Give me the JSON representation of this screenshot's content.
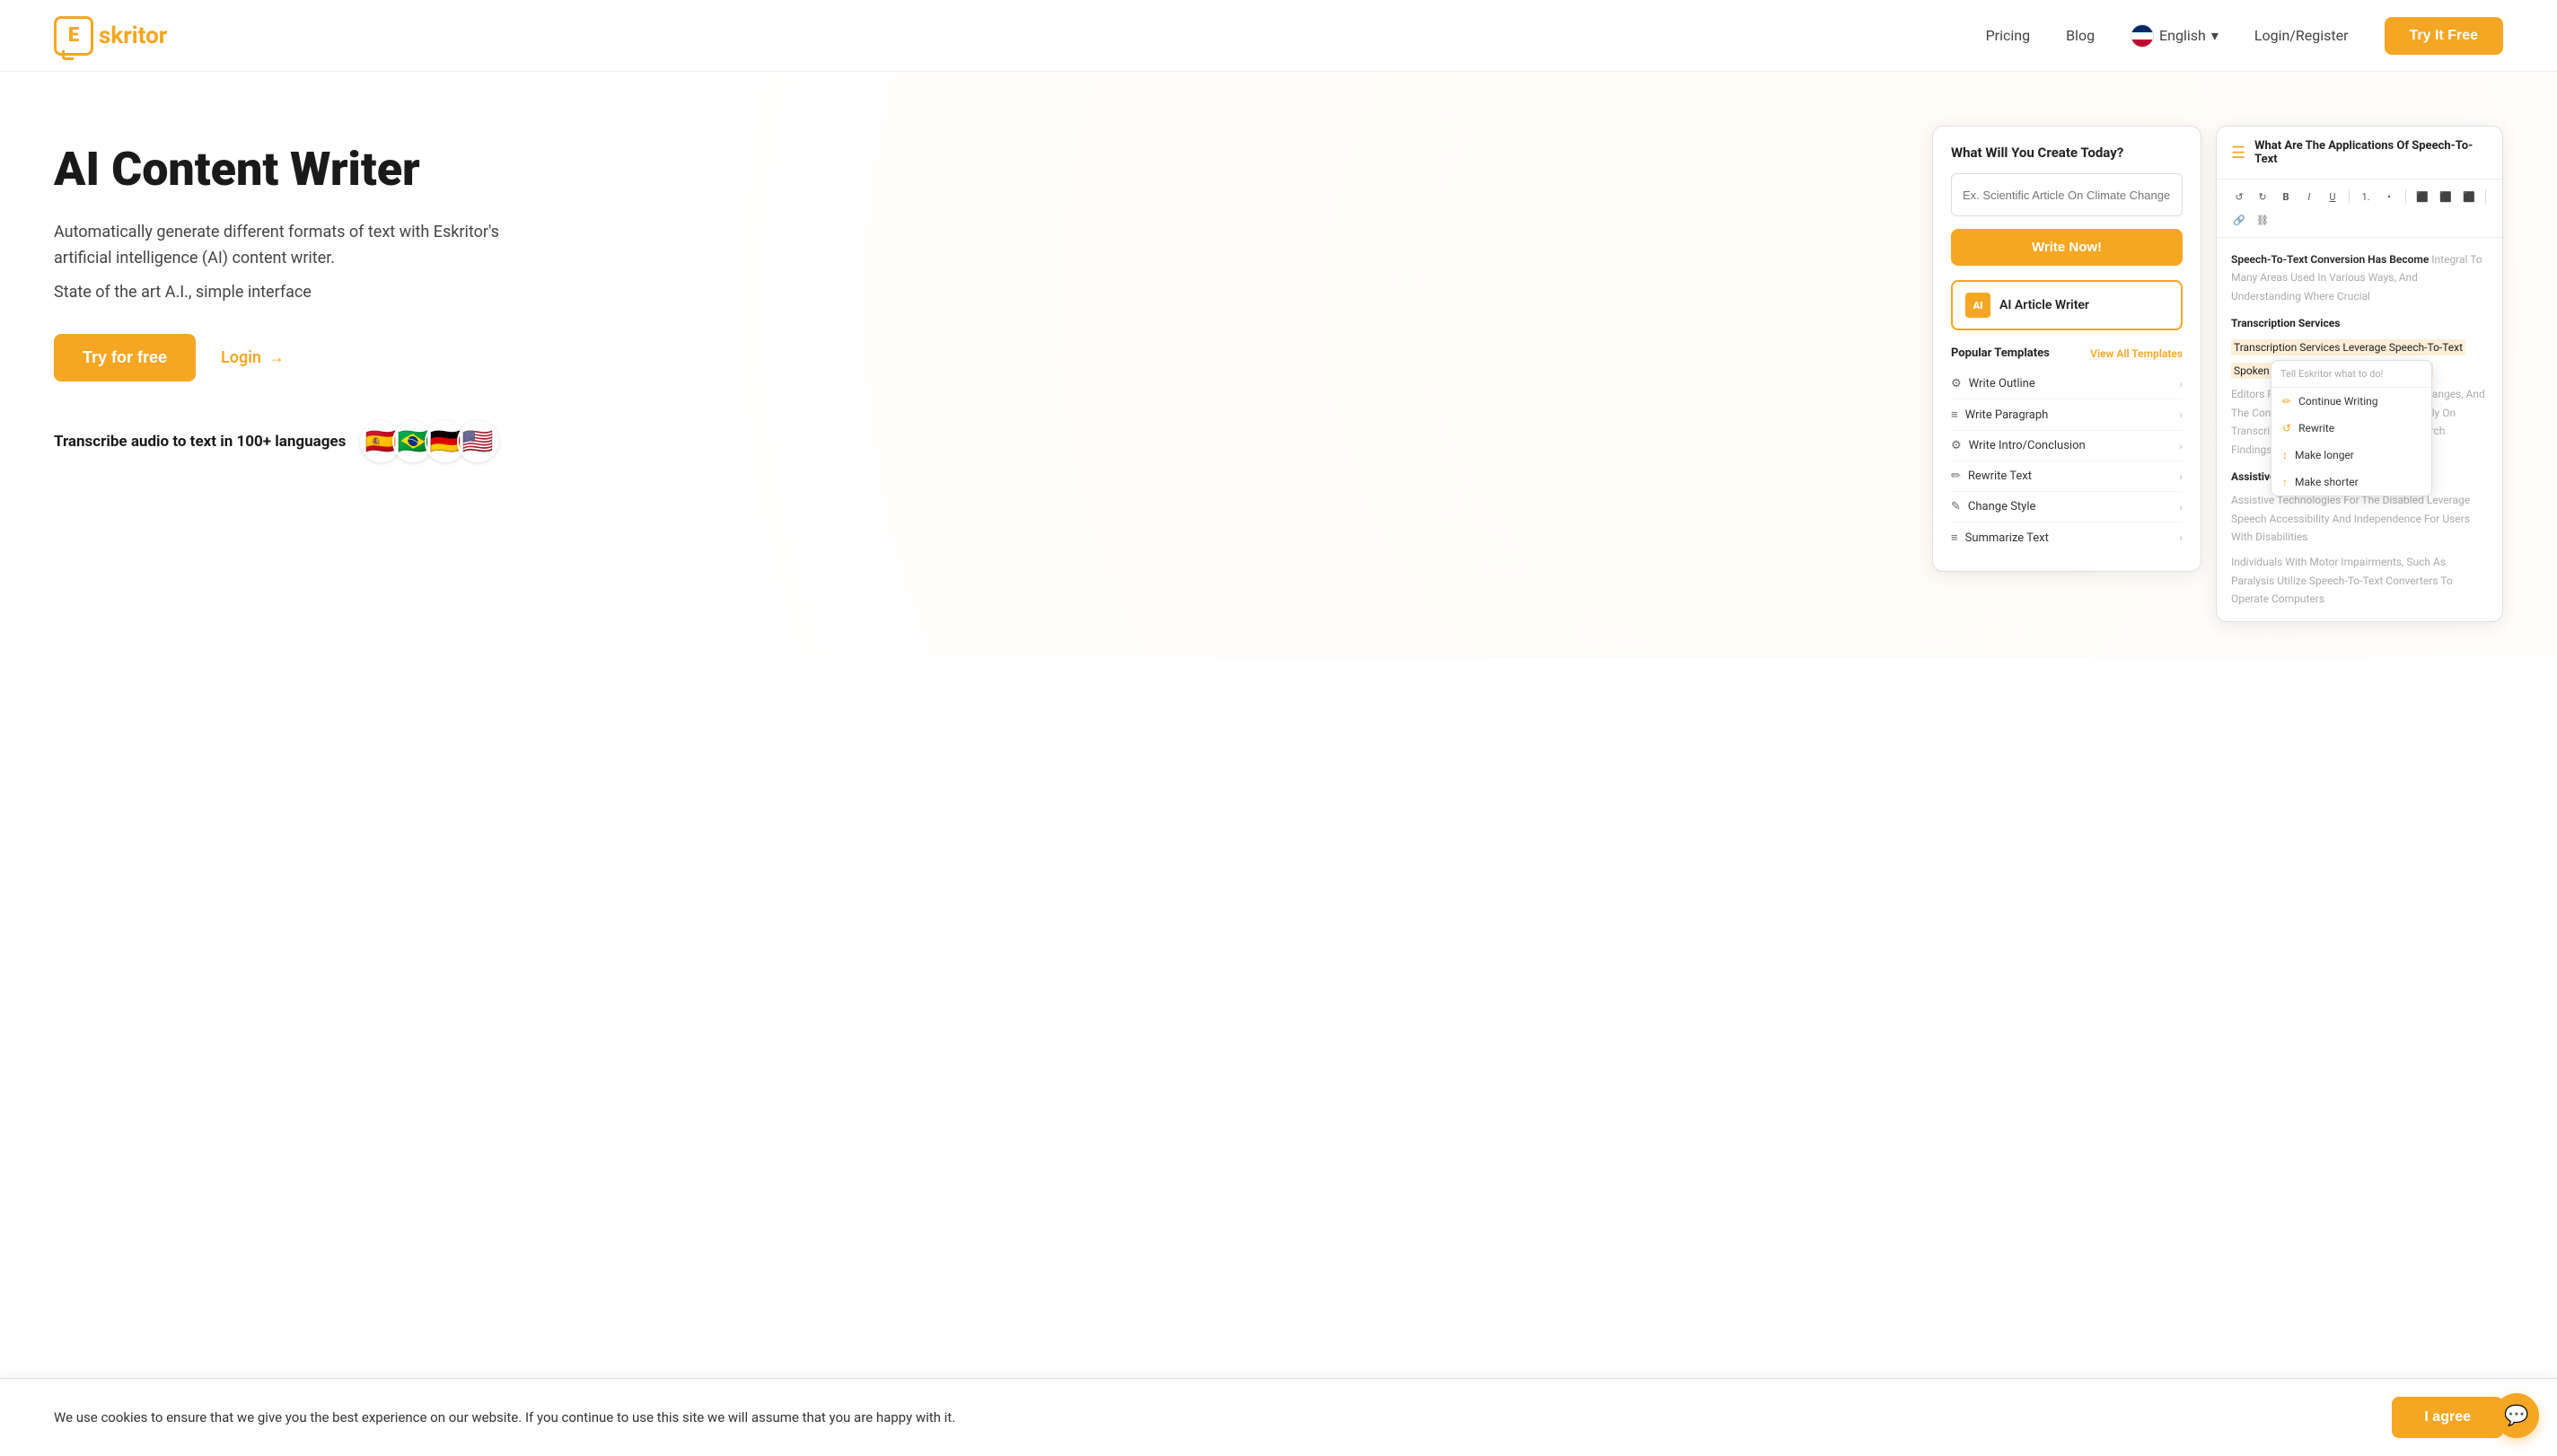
{
  "nav": {
    "logo_letter": "E",
    "logo_name": "skritor",
    "pricing": "Pricing",
    "blog": "Blog",
    "language": "English",
    "login_register": "Login/Register",
    "try_it_free": "Try It Free"
  },
  "hero": {
    "title": "AI Content Writer",
    "desc": "Automatically generate different formats of text with Eskritor's artificial intelligence (AI) content writer.",
    "sub": "State of the art A.I., simple interface",
    "btn_try": "Try for free",
    "btn_login": "Login",
    "transcribe": "Transcribe audio to text in 100+ languages",
    "flags": [
      "🇪🇸",
      "🇧🇷",
      "🇩🇪",
      "🇺🇸"
    ]
  },
  "left_panel": {
    "title": "What Will You Create Today?",
    "input_placeholder": "Ex. Scientific Article On Climate Change",
    "write_now": "Write Now!",
    "ai_article": "AI Article Writer",
    "popular_templates": "Popular Templates",
    "view_all": "View All Templates",
    "templates": [
      {
        "icon": "⚙",
        "label": "Write Outline"
      },
      {
        "icon": "≡",
        "label": "Write Paragraph"
      },
      {
        "icon": "⚙",
        "label": "Write Intro/Conclusion"
      },
      {
        "icon": "✏",
        "label": "Rewrite Text"
      },
      {
        "icon": "✎",
        "label": "Change Style"
      },
      {
        "icon": "≡",
        "label": "Summarize Text"
      }
    ]
  },
  "right_panel": {
    "title": "What Are The Applications Of Speech-To-Text",
    "editor_content": {
      "intro": "Speech-To-Text Conversion Has Become Integral To Many Areas Used In Various Ways, And Understanding Where Crucial",
      "section1": "Transcription Services",
      "highlighted_line1": "Transcription Services Leverage Speech-To-Text",
      "highlighted_line2": "Spoken Audio Into Written Text Efficiently",
      "body": "Editors Rewrite Interviews, Meetings, Exchanges, And The Convenience Of Quickly And Accurately On Transcription Services To Generate Research Findings",
      "section2": "Assistive Technologies For The Disabled",
      "body2": "Assistive Technologies For The Disabled Leverage Speech Accessibility And Independence For Users With Disabilities",
      "body3": "Individuals With Motor Impairments, Such As Paralysis Utilize Speech-To-Text Converters To Operate Computers"
    },
    "context_menu": {
      "placeholder": "Tell Eskritor what to do!",
      "items": [
        "Continue Writing",
        "Rewrite",
        "Make longer",
        "Make shorter"
      ]
    }
  },
  "cookie": {
    "text": "We use cookies to ensure that we give you the best experience on our website. If you continue to use this site we will assume that you are happy with it.",
    "agree": "I agree"
  }
}
